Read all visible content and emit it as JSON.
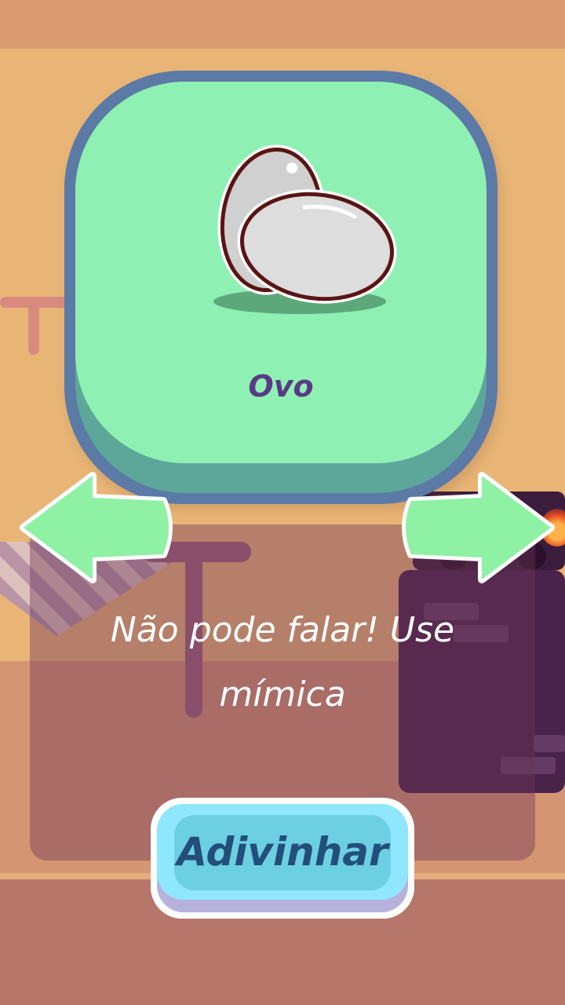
{
  "card": {
    "word": "Ovo",
    "image_icon": "eggs-icon"
  },
  "instruction": {
    "text": "Não pode falar! Use mímica"
  },
  "guess_button": {
    "label": "Adivinhar"
  },
  "navigation": {
    "prev_icon": "arrow-left-icon",
    "next_icon": "arrow-right-icon"
  },
  "colors": {
    "card_face": "#8ef1b3",
    "card_border": "#5b7aa6",
    "word_color": "#5a3a86",
    "arrow_fill": "#8ef1a4",
    "button_fill": "#8fe6ff",
    "button_text": "#234e78"
  }
}
